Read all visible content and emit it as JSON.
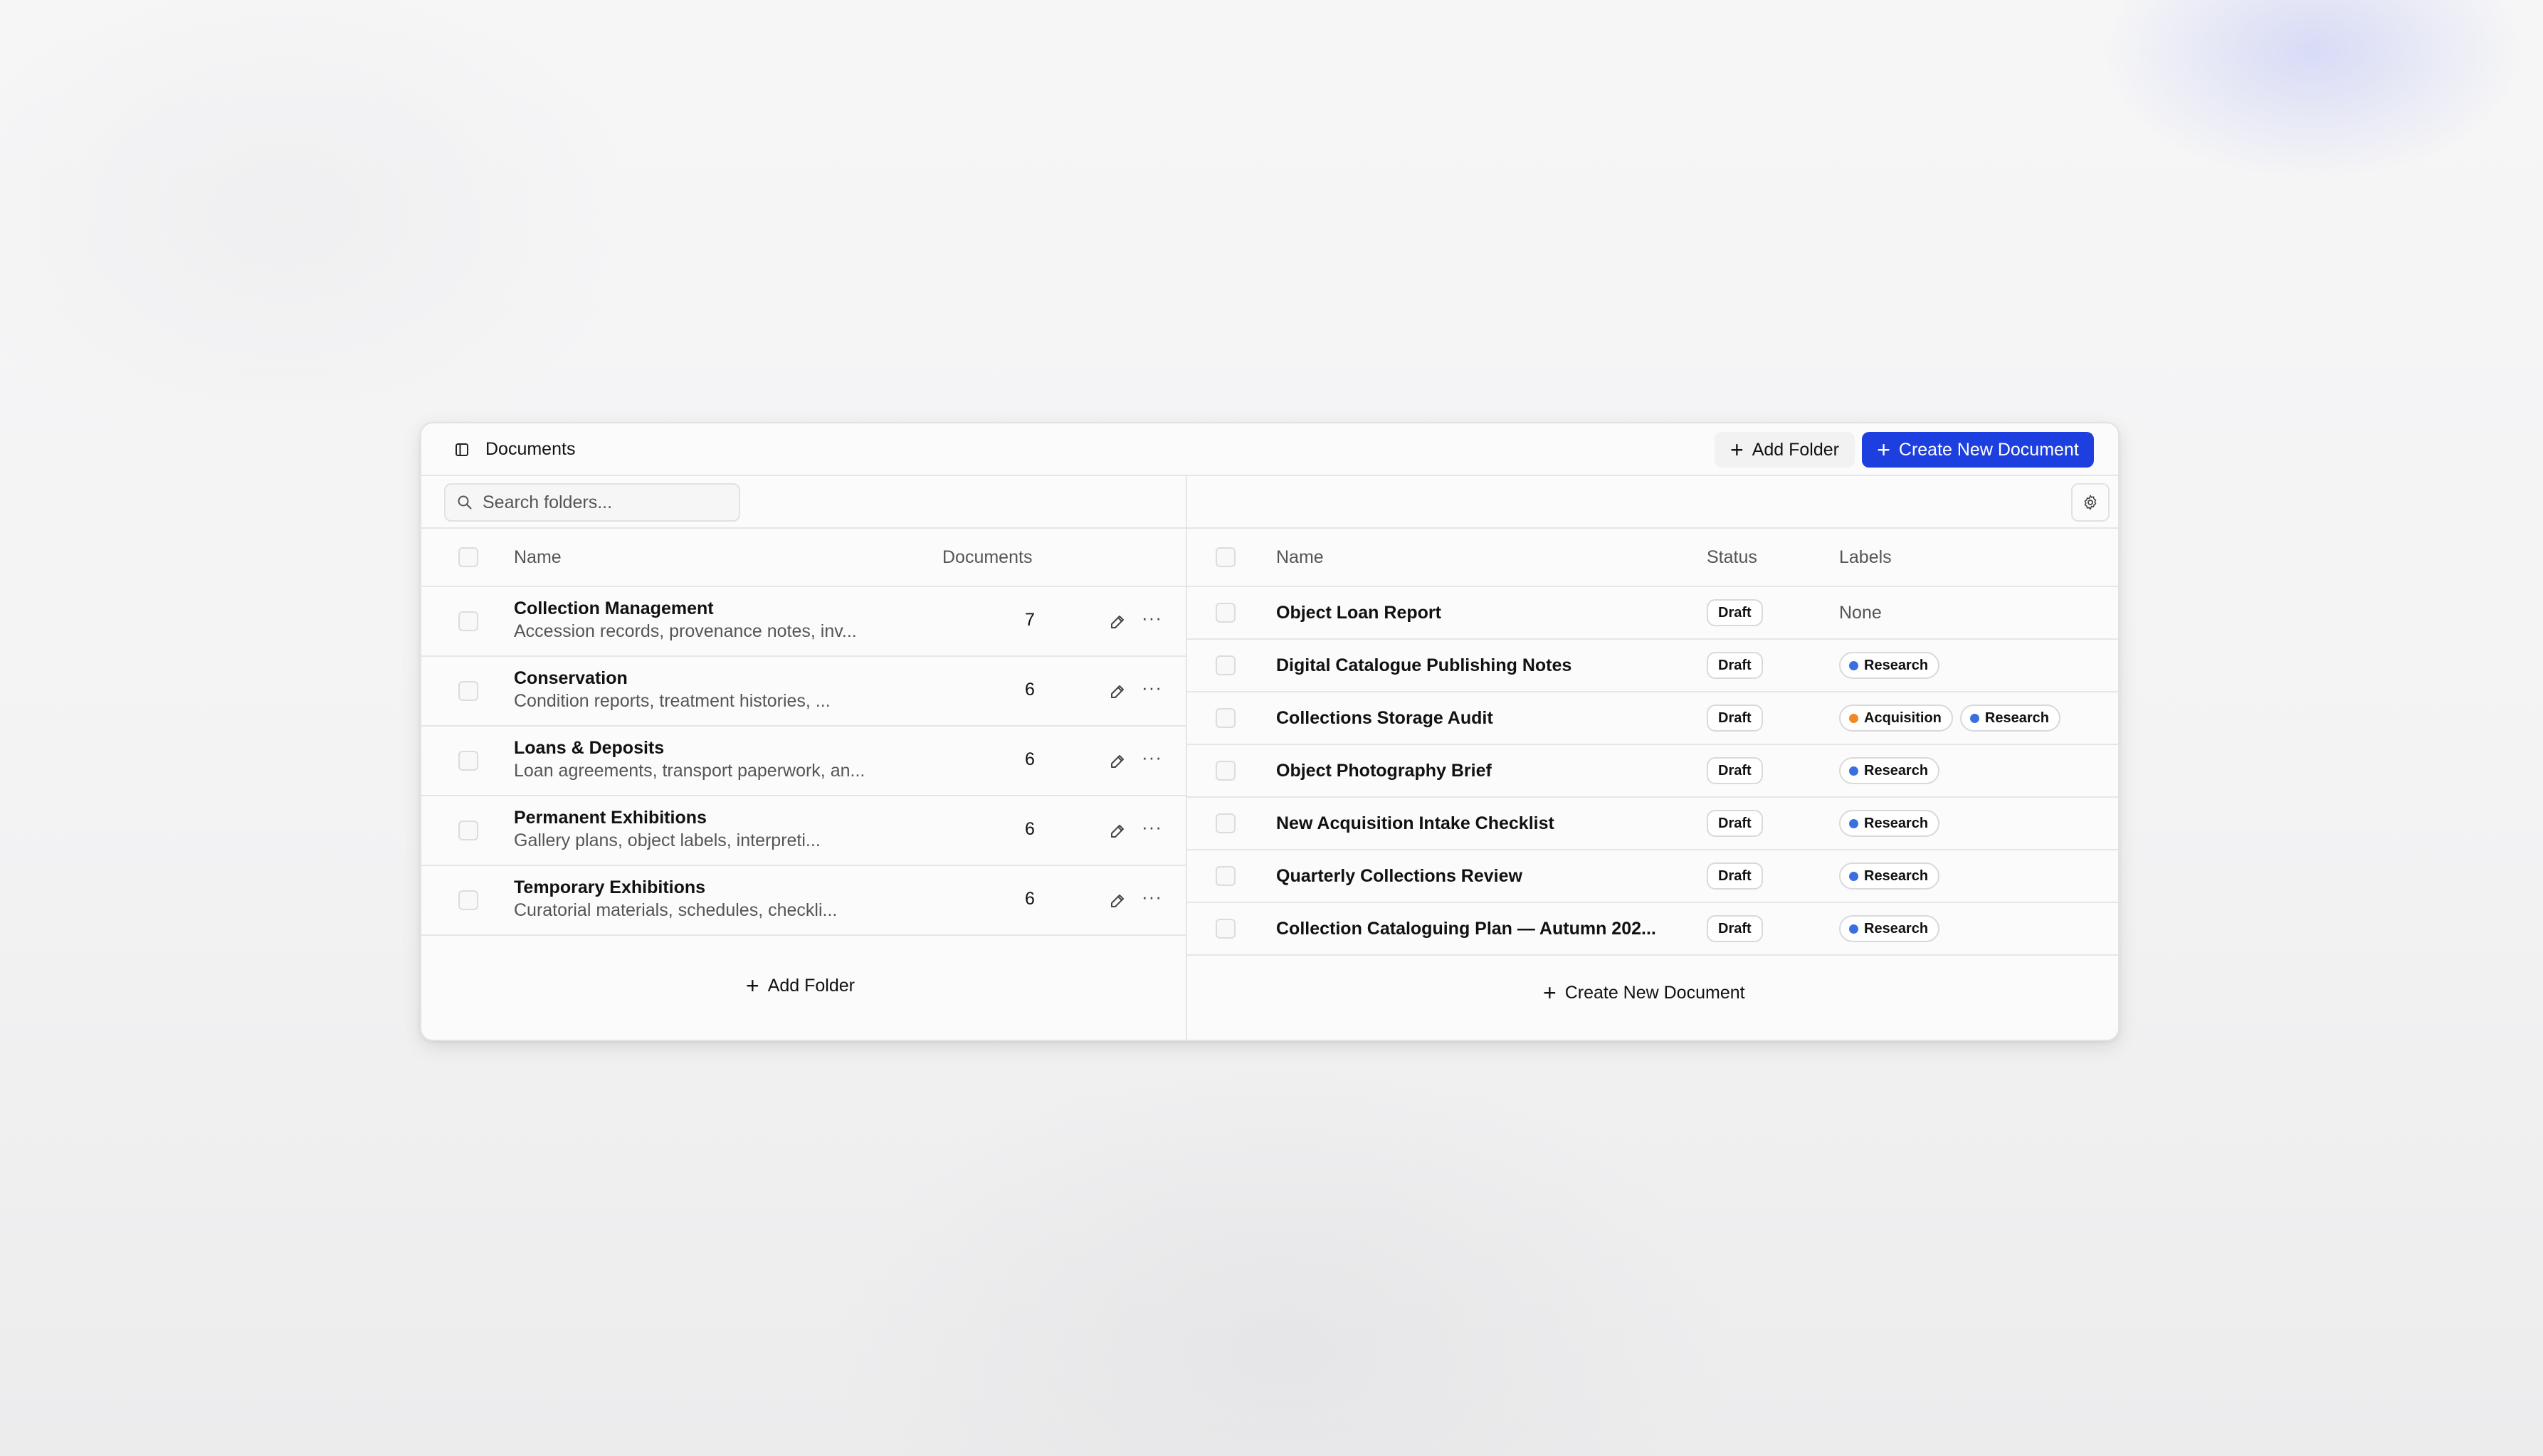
{
  "header": {
    "title": "Documents",
    "add_folder_label": "Add Folder",
    "create_document_label": "Create New Document"
  },
  "folders_panel": {
    "search_placeholder": "Search folders...",
    "columns": {
      "name": "Name",
      "documents": "Documents"
    },
    "rows": [
      {
        "name": "Collection Management",
        "description": "Accession records, provenance notes, inv...",
        "count": "7"
      },
      {
        "name": "Conservation",
        "description": "Condition reports, treatment histories, ...",
        "count": "6"
      },
      {
        "name": "Loans & Deposits",
        "description": "Loan agreements, transport paperwork, an...",
        "count": "6"
      },
      {
        "name": "Permanent Exhibitions",
        "description": "Gallery plans, object labels, interpreti...",
        "count": "6"
      },
      {
        "name": "Temporary Exhibitions",
        "description": "Curatorial materials, schedules, checkli...",
        "count": "6"
      }
    ],
    "footer_add_label": "Add Folder"
  },
  "documents_panel": {
    "columns": {
      "name": "Name",
      "status": "Status",
      "labels": "Labels"
    },
    "rows": [
      {
        "name": "Object Loan Report",
        "status": "Draft",
        "labels": [],
        "labels_empty_text": "None"
      },
      {
        "name": "Digital Catalogue Publishing Notes",
        "status": "Draft",
        "labels": [
          "Research"
        ]
      },
      {
        "name": "Collections Storage Audit",
        "status": "Draft",
        "labels": [
          "Acquisition",
          "Research"
        ]
      },
      {
        "name": "Object Photography Brief",
        "status": "Draft",
        "labels": [
          "Research"
        ]
      },
      {
        "name": "New Acquisition Intake Checklist",
        "status": "Draft",
        "labels": [
          "Research"
        ]
      },
      {
        "name": "Quarterly Collections Review",
        "status": "Draft",
        "labels": [
          "Research"
        ]
      },
      {
        "name": "Collection Cataloguing Plan — Autumn 202...",
        "status": "Draft",
        "labels": [
          "Research"
        ]
      }
    ],
    "footer_create_label": "Create New Document"
  },
  "label_colors": {
    "Research": "#3b6fe0",
    "Acquisition": "#f08a24"
  },
  "colors": {
    "accent": "#1d3fe0"
  }
}
